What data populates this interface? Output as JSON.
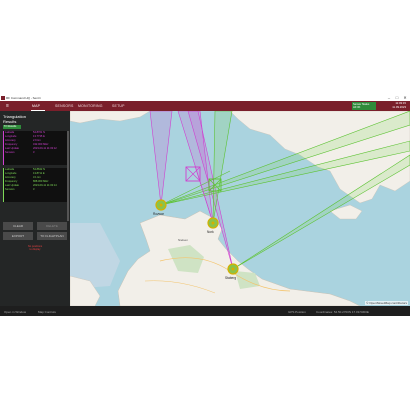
{
  "window": {
    "title": "RF Command HQ - Sentri",
    "minimize": "–",
    "maximize": "□",
    "close": "✕"
  },
  "nav": {
    "menu_icon": "≡",
    "tabs": [
      {
        "label": "MAP",
        "active": true
      },
      {
        "label": "SENSORS",
        "active": false
      },
      {
        "label": "MONITORING",
        "active": false
      },
      {
        "label": "SETUP",
        "active": false
      }
    ],
    "status_line1": "Sensor Status",
    "status_line2": "All OK",
    "time": "11:03:15",
    "date": "11.09.2023",
    "accent": "#7a1f2b"
  },
  "panel": {
    "title_line1": "Triangulation",
    "title_line2": "Results",
    "badge": "Tri Results",
    "results": [
      {
        "color": "#d040d0",
        "rows": [
          [
            "Latitude",
            "54.8761 N"
          ],
          [
            "Longitude",
            "13.7735 E"
          ],
          [
            "Accuracy",
            "2.9 km"
          ],
          [
            "Frequency",
            "432.000 MHz"
          ],
          [
            "Last Update",
            "2023-09-11 11:03:12"
          ],
          [
            "Sensors",
            "3"
          ]
        ]
      },
      {
        "color": "#7ed957",
        "rows": [
          [
            "Latitude",
            "54.8842 N"
          ],
          [
            "Longitude",
            "13.8711 E"
          ],
          [
            "Accuracy",
            "3.1 km"
          ],
          [
            "Frequency",
            "868.300 MHz"
          ],
          [
            "Last Update",
            "2023-09-11 11:03:14"
          ],
          [
            "Sensors",
            "3"
          ]
        ]
      }
    ],
    "buttons": [
      {
        "label": "CLEAR"
      },
      {
        "label": "DELETE"
      },
      {
        "label": "EXPORT"
      },
      {
        "label": "TO FLIGHTPLAN"
      }
    ],
    "note_line1": "No positions",
    "note_line2": "to display"
  },
  "map": {
    "stations": [
      {
        "name": "Rozwar"
      },
      {
        "name": "Nork"
      },
      {
        "name": "Staberg"
      }
    ],
    "town_label": "Nielsen",
    "attribution": "© OpenStreetMap contributors"
  },
  "status": {
    "left": "Open in Window",
    "left2": "Map Controls",
    "gps": "GPS Position",
    "coords": "Coordinates: 54.50.2700N 17.09.5300E"
  }
}
